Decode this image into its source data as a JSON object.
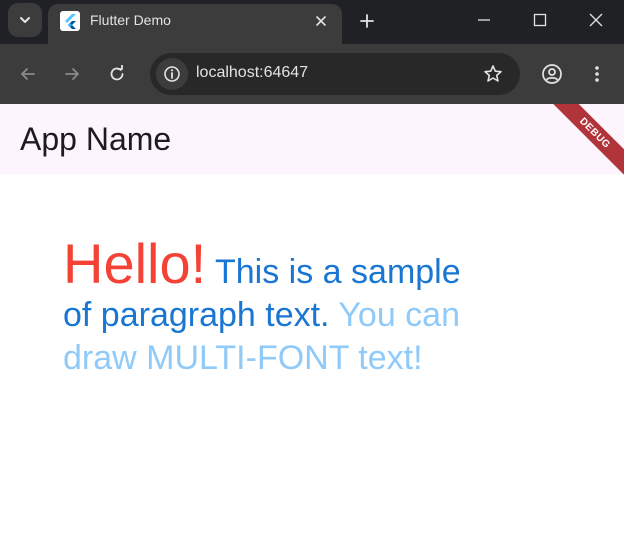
{
  "browser": {
    "tab": {
      "title": "Flutter Demo"
    },
    "omnibox": {
      "url": "localhost:64647"
    }
  },
  "app": {
    "title": "App Name",
    "debug_banner": "DEBUG",
    "paragraph": {
      "hello": "Hello!",
      "sentence1": " This is a sample of paragraph text.",
      "sentence2": " You can draw MULTI-FONT text!"
    }
  },
  "colors": {
    "hello": "#f44336",
    "body_text": "#1976d2",
    "light_text": "#90caf9",
    "appbar_bg": "#fdf5fd",
    "debug_banner": "#b0343a"
  }
}
